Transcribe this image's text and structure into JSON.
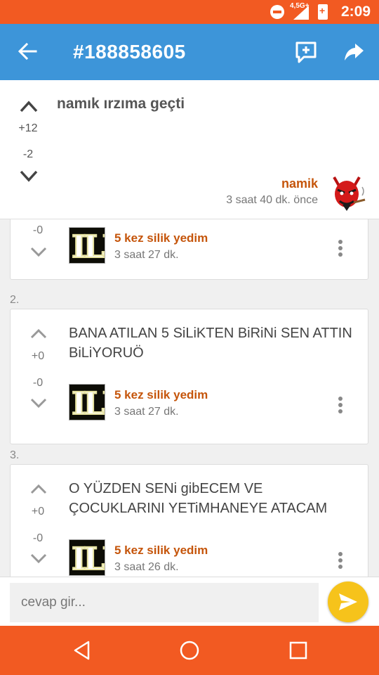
{
  "status_bar": {
    "time": "2:09",
    "network": "4,5G+",
    "colors": {
      "background": "#f25a22"
    }
  },
  "app_bar": {
    "title": "#188858605",
    "icons": [
      "back-arrow-icon",
      "add-reply-icon",
      "share-icon"
    ],
    "colors": {
      "background": "#3d95d9"
    }
  },
  "entry": {
    "text": "namık ırzıma geçti",
    "upvotes": "+12",
    "downvotes": "-2",
    "author": "namik",
    "time": "3 saat 40 dk. önce"
  },
  "replies": [
    {
      "downvotes": "-0",
      "author": "5 kez silik yedim",
      "time": "3 saat 27 dk."
    },
    {
      "number": "2.",
      "text": "BANA ATILAN 5 SiLiKTEN BiRiNi SEN ATTIN BiLiYORUÖ",
      "upvotes": "+0",
      "downvotes": "-0",
      "author": "5 kez silik yedim",
      "time": "3 saat 27 dk."
    },
    {
      "number": "3.",
      "text": "O YÜZDEN SENi gibECEM VE ÇOCUKLARINI YETiMHANEYE ATACAM",
      "upvotes": "+0",
      "downvotes": "-0",
      "author": "5 kez silik yedim",
      "time": "3 saat 26 dk."
    }
  ],
  "avatar_text": "ILI",
  "reply_bar": {
    "placeholder": "cevap gir...",
    "send_color": "#f6c31b"
  },
  "nav_bar": {
    "icons": [
      "back-triangle-icon",
      "home-circle-icon",
      "recents-square-icon"
    ],
    "colors": {
      "background": "#f25a22"
    }
  },
  "colors": {
    "author": "#c5550b",
    "text": "#444444"
  }
}
